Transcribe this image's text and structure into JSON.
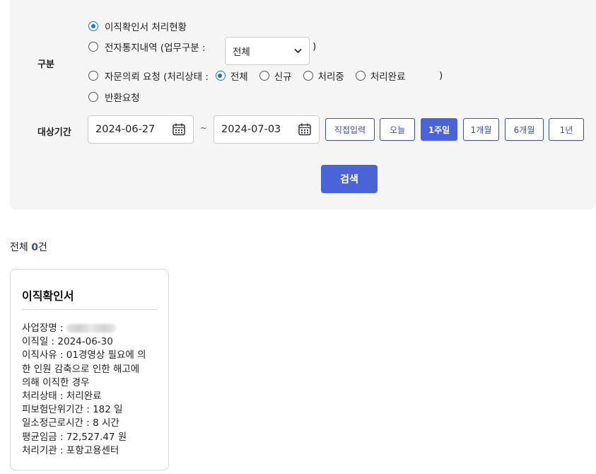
{
  "filter": {
    "category_label": "구분",
    "options": [
      {
        "label": "이직확인서 처리현황",
        "selected": true
      },
      {
        "label": "전자통지내역 (업무구분 :",
        "selected": false
      },
      {
        "label": "자문의뢰 요청 (처리상태 :",
        "selected": false
      },
      {
        "label": "반환요청",
        "selected": false
      }
    ],
    "work_type": {
      "value": "전체",
      "close_paren": ")"
    },
    "status_options": [
      {
        "label": "전체",
        "selected": true
      },
      {
        "label": "신규",
        "selected": false
      },
      {
        "label": "처리중",
        "selected": false
      },
      {
        "label": "처리완료",
        "selected": false
      }
    ],
    "status_close_paren": ")",
    "period_label": "대상기간",
    "start_date": "2024-06-27",
    "end_date": "2024-07-03",
    "tilde": "~",
    "period_buttons": [
      {
        "label": "직접입력",
        "active": false
      },
      {
        "label": "오늘",
        "active": false
      },
      {
        "label": "1주일",
        "active": true
      },
      {
        "label": "1개월",
        "active": false
      },
      {
        "label": "6개월",
        "active": false
      },
      {
        "label": "1년",
        "active": false
      }
    ],
    "search_label": "검색"
  },
  "results": {
    "total_prefix": "전체 ",
    "total_count": "0",
    "total_suffix": "건",
    "card": {
      "title": "이직확인서",
      "workplace_label": "사업장명 : ",
      "separation_date": "이직일 : 2024-06-30",
      "reason_line1": "이직사유 : 01경영상 필요에 의",
      "reason_line2": "한 인원 감축으로 인한 해고에",
      "reason_line3": "의해 이직한 경우",
      "status": "처리상태 : 처리완료",
      "insured_period": "피보험단위기간 : 182 일",
      "work_hours": "일소정근로시간 : 8 시간",
      "avg_wage": "평균임금 : 72,527.47 원",
      "office": "처리기관 : 포항고용센터"
    }
  },
  "colors": {
    "accent": "#4a63d8",
    "panel_bg": "#f5f5f6",
    "radio_on": "#1a73e8"
  }
}
